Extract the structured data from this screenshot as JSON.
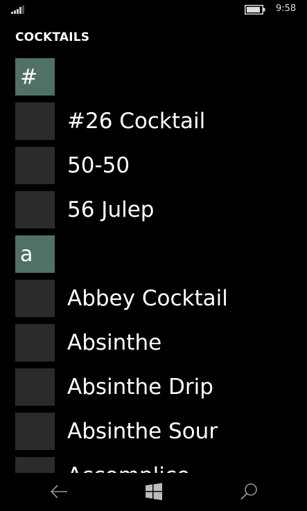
{
  "status_bar": {
    "time": "9:58",
    "signal_icon": "signal-bars-icon",
    "battery_icon": "battery-icon"
  },
  "app": {
    "title": "COCKTAILS"
  },
  "list": {
    "groups": [
      {
        "header": "#",
        "items": [
          "#26 Cocktail",
          "50-50",
          "56 Julep"
        ]
      },
      {
        "header": "a",
        "items": [
          "Abbey Cocktail",
          "Absinthe",
          "Absinthe Drip",
          "Absinthe Sour",
          "Accomplice"
        ]
      }
    ]
  },
  "nav": {
    "back_icon": "back-arrow-icon",
    "home_icon": "windows-logo-icon",
    "search_icon": "search-icon"
  },
  "colors": {
    "background": "#000000",
    "group_tile": "#507068",
    "item_tile": "#2b2b2b",
    "text": "#ffffff"
  }
}
